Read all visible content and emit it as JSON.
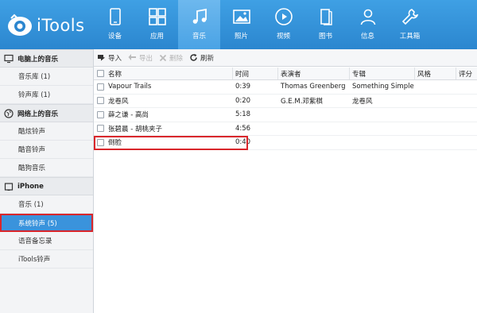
{
  "app": {
    "logo_text": "iTools"
  },
  "nav": [
    {
      "label": "设备",
      "icon": "phone-icon"
    },
    {
      "label": "应用",
      "icon": "apps-grid-icon"
    },
    {
      "label": "音乐",
      "icon": "music-note-icon",
      "active": true
    },
    {
      "label": "照片",
      "icon": "photo-icon"
    },
    {
      "label": "视频",
      "icon": "play-icon"
    },
    {
      "label": "图书",
      "icon": "book-icon"
    },
    {
      "label": "信息",
      "icon": "person-icon"
    },
    {
      "label": "工具箱",
      "icon": "wrench-icon"
    }
  ],
  "sidebar": {
    "sections": [
      {
        "title": "电脑上的音乐",
        "icon": "monitor-icon",
        "items": [
          {
            "label": "音乐库 (1)"
          },
          {
            "label": "铃声库 (1)"
          }
        ]
      },
      {
        "title": "网络上的音乐",
        "icon": "globe-icon",
        "items": [
          {
            "label": "酷炫铃声"
          },
          {
            "label": "酷音铃声"
          },
          {
            "label": "酷狗音乐"
          }
        ]
      },
      {
        "title": "iPhone",
        "icon": "phone-icon",
        "items": [
          {
            "label": "音乐 (1)"
          },
          {
            "label": "系统铃声 (5)",
            "selected": true
          },
          {
            "label": "语音备忘录"
          },
          {
            "label": "iTools铃声"
          }
        ]
      }
    ]
  },
  "toolbar": {
    "import_label": "导入",
    "export_label": "导出",
    "delete_label": "删除",
    "refresh_label": "刷新"
  },
  "table": {
    "columns": {
      "name": "名称",
      "time": "时间",
      "artist": "表演者",
      "album": "专辑",
      "style": "风格",
      "rating": "评分"
    },
    "rows": [
      {
        "name": "Vapour Trails",
        "time": "0:39",
        "artist": "Thomas Greenberg",
        "album": "Something Simple"
      },
      {
        "name": "龙卷风",
        "time": "0:20",
        "artist": "G.E.M.邓紫棋",
        "album": "龙卷风"
      },
      {
        "name": "薛之谦 - 高尚",
        "time": "5:18",
        "artist": "",
        "album": ""
      },
      {
        "name": "张碧晨 - 胡桃夹子",
        "time": "4:56",
        "artist": "",
        "album": ""
      },
      {
        "name": "倒脸",
        "time": "0:40",
        "artist": "",
        "album": ""
      }
    ]
  },
  "colors": {
    "topbar": "#2b86cf",
    "accent": "#3a93dc",
    "highlight": "#d9262b"
  }
}
